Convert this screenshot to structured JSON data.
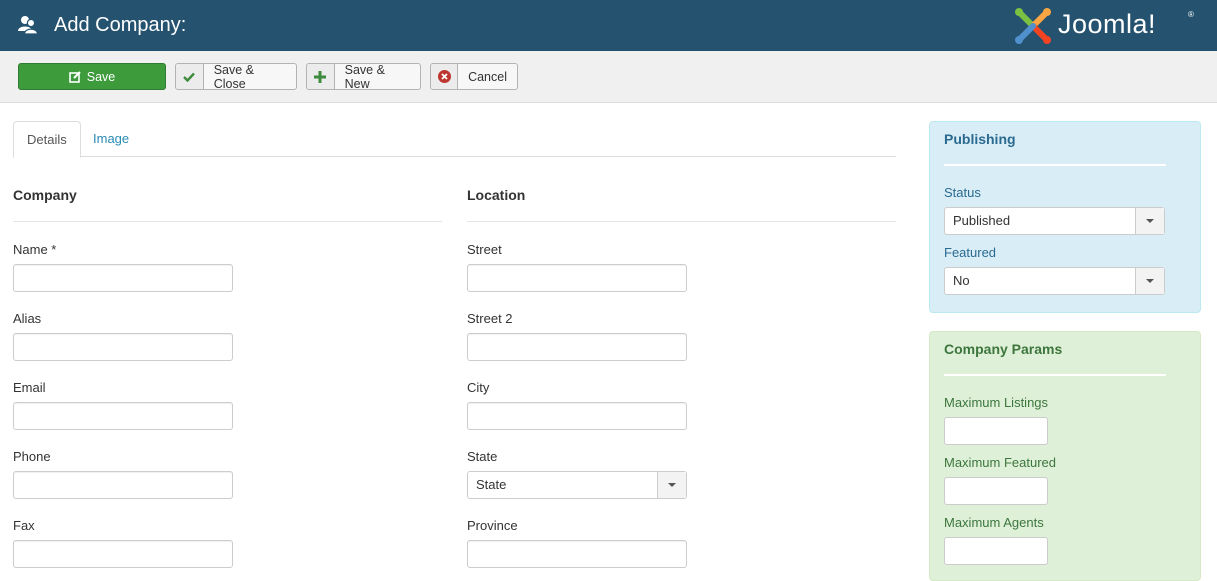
{
  "header": {
    "title": "Add Company:",
    "user_icon": "users-icon",
    "logo_text": "Joomla!",
    "logo_reg": "®"
  },
  "toolbar": {
    "save_label": "Save",
    "save_close_label": "Save & Close",
    "save_new_label": "Save & New",
    "cancel_label": "Cancel",
    "colors": {
      "save": "#3d9b3c",
      "check": "#3d8b3d",
      "plus": "#3d8b3d",
      "cancel": "#bd362f"
    }
  },
  "tabs": [
    {
      "label": "Details",
      "active": true
    },
    {
      "label": "Image",
      "active": false
    }
  ],
  "company": {
    "title": "Company",
    "fields": [
      {
        "label": "Name *",
        "value": ""
      },
      {
        "label": "Alias",
        "value": ""
      },
      {
        "label": "Email",
        "value": ""
      },
      {
        "label": "Phone",
        "value": ""
      },
      {
        "label": "Fax",
        "value": ""
      }
    ]
  },
  "location": {
    "title": "Location",
    "fields": [
      {
        "label": "Street",
        "value": ""
      },
      {
        "label": "Street 2",
        "value": ""
      },
      {
        "label": "City",
        "value": ""
      },
      {
        "label": "State",
        "value": "State"
      },
      {
        "label": "Province",
        "value": ""
      }
    ]
  },
  "publishing": {
    "title": "Publishing",
    "status_label": "Status",
    "status_value": "Published",
    "featured_label": "Featured",
    "featured_value": "No"
  },
  "params": {
    "title": "Company Params",
    "fields": [
      {
        "label": "Maximum Listings",
        "value": ""
      },
      {
        "label": "Maximum Featured",
        "value": ""
      },
      {
        "label": "Maximum Agents",
        "value": ""
      }
    ]
  }
}
